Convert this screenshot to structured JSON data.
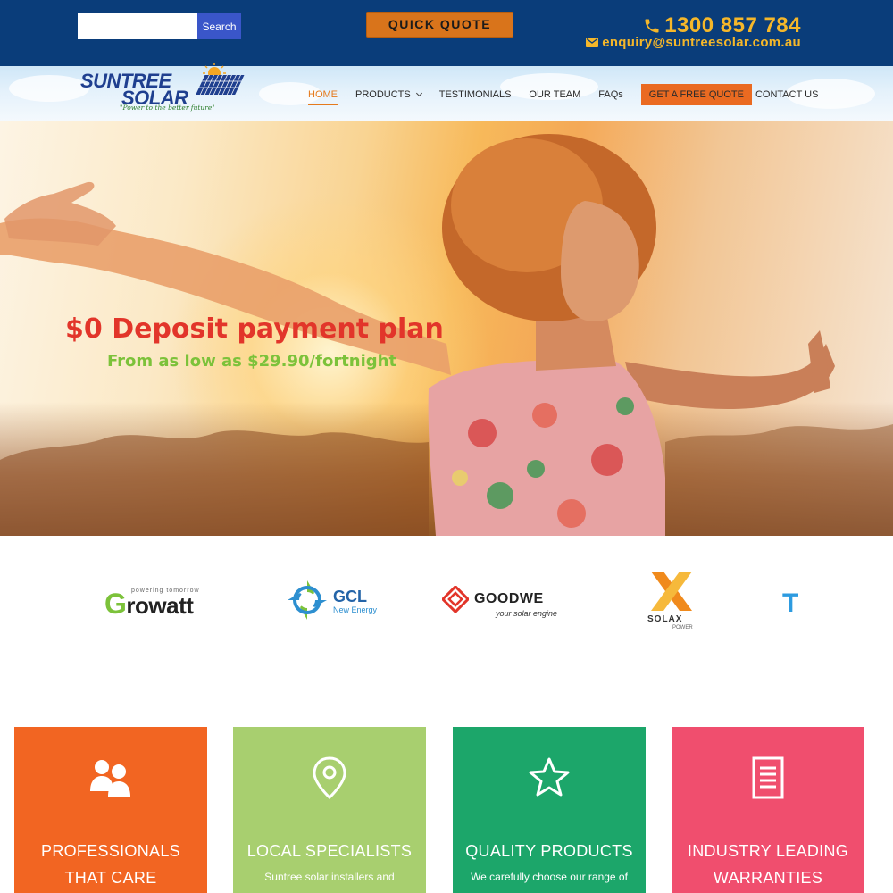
{
  "topbar": {
    "search_placeholder": "",
    "search_button": "Search",
    "quick_quote": "QUICK QUOTE",
    "phone": "1300 857 784",
    "email": "enquiry@suntreesolar.com.au"
  },
  "logo": {
    "line1": "SUNTREE",
    "line2": "SOLAR",
    "tagline": "\"Power to the better future\""
  },
  "nav": {
    "items": [
      {
        "label": "HOME",
        "active": true
      },
      {
        "label": "PRODUCTS",
        "dropdown": true
      },
      {
        "label": "TESTIMONIALS"
      },
      {
        "label": "OUR TEAM"
      },
      {
        "label": "FAQs"
      },
      {
        "label": "GET A FREE QUOTE",
        "cta": true
      },
      {
        "label": "CONTACT US"
      }
    ]
  },
  "hero": {
    "title": "$0 Deposit payment plan",
    "subtitle": "From as low as $29.90/fortnight"
  },
  "brands": {
    "growatt": {
      "name": "Growatt",
      "tag": "powering tomorrow"
    },
    "gcl": {
      "name": "GCL",
      "sub": "New Energy"
    },
    "goodwe": {
      "name": "GOODWE",
      "sub": "your solar engine"
    },
    "solax": {
      "name": "SOLAX",
      "sub": "POWER"
    },
    "partial": {
      "name": "T"
    }
  },
  "cards": [
    {
      "title": "PROFESSIONALS THAT CARE",
      "text": "",
      "color": "#f26522",
      "icon": "users-icon"
    },
    {
      "title": "LOCAL SPECIALISTS",
      "text": "Suntree solar installers and",
      "color": "#a8cf6f",
      "icon": "map-pin-icon"
    },
    {
      "title": "QUALITY PRODUCTS",
      "text": "We carefully choose our range of",
      "color": "#1ca66a",
      "icon": "star-icon"
    },
    {
      "title": "INDUSTRY LEADING WARRANTIES",
      "text": "",
      "color": "#f04e6e",
      "icon": "document-icon"
    }
  ],
  "colors": {
    "topbar": "#0a3d7a",
    "accent_orange": "#e57a1c",
    "phone_yellow": "#f5b72a",
    "hero_title": "#e2352a",
    "hero_sub": "#7cc23a"
  }
}
